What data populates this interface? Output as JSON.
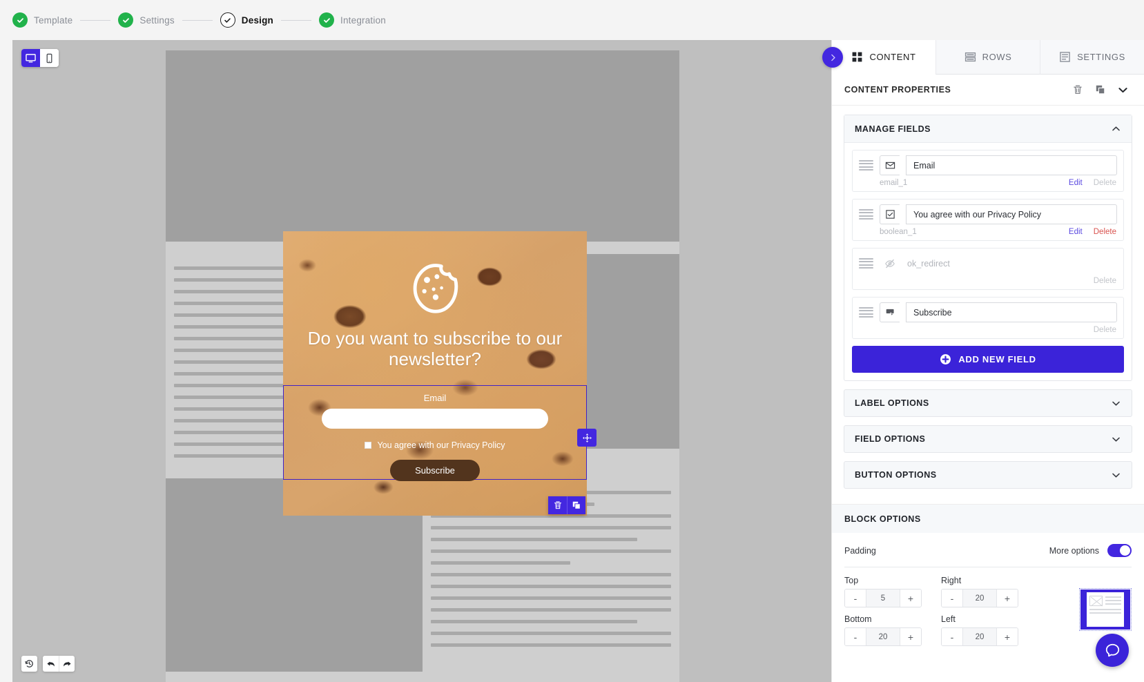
{
  "stepper": {
    "steps": [
      {
        "label": "Template",
        "state": "done"
      },
      {
        "label": "Settings",
        "state": "done"
      },
      {
        "label": "Design",
        "state": "current"
      },
      {
        "label": "Integration",
        "state": "done"
      }
    ]
  },
  "canvas": {
    "view_desktop_icon": "desktop-icon",
    "view_mobile_icon": "mobile-icon",
    "history_icon": "history-icon",
    "undo_icon": "undo-icon",
    "redo_icon": "redo-icon"
  },
  "popup": {
    "logo_icon": "cookie-icon",
    "title": "Do you want to subscribe to our newsletter?",
    "email_label": "Email",
    "email_value": "",
    "email_placeholder": "",
    "consent_label": "You agree with our Privacy Policy",
    "consent_checked": false,
    "submit_label": "Subscribe",
    "move_handle_icon": "move-icon",
    "delete_icon": "trash-icon",
    "duplicate_icon": "duplicate-icon"
  },
  "panel": {
    "collapse_icon": "chevron-right-icon",
    "tabs": [
      {
        "label": "CONTENT",
        "icon": "grid-icon",
        "active": true
      },
      {
        "label": "ROWS",
        "icon": "rows-icon",
        "active": false
      },
      {
        "label": "SETTINGS",
        "icon": "settings-list-icon",
        "active": false
      }
    ],
    "properties": {
      "title": "CONTENT PROPERTIES",
      "delete_icon": "trash-icon",
      "duplicate_icon": "duplicate-icon",
      "collapse_icon": "chevron-down-icon"
    },
    "manage_fields": {
      "title": "MANAGE FIELDS",
      "collapse_icon": "chevron-up-icon",
      "fields": [
        {
          "icon": "envelope-icon",
          "name": "Email",
          "key": "email_1",
          "edit_label": "Edit",
          "delete_label": "Delete",
          "edit_enabled": true,
          "delete_enabled": false,
          "has_name_box": true
        },
        {
          "icon": "checkbox-icon",
          "name": "You agree with our Privacy Policy",
          "key": "boolean_1",
          "edit_label": "Edit",
          "delete_label": "Delete",
          "edit_enabled": true,
          "delete_enabled": true,
          "has_name_box": true
        },
        {
          "icon": "hidden-eye-icon",
          "name": "ok_redirect",
          "key": "",
          "edit_label": "",
          "delete_label": "Delete",
          "edit_enabled": false,
          "delete_enabled": false,
          "has_name_box": false
        },
        {
          "icon": "button-click-icon",
          "name": "Subscribe",
          "key": "",
          "edit_label": "",
          "delete_label": "Delete",
          "edit_enabled": false,
          "delete_enabled": false,
          "has_name_box": true
        }
      ],
      "add_button_label": "ADD NEW FIELD",
      "add_button_icon": "plus-circle-icon"
    },
    "accordions": [
      {
        "label": "LABEL OPTIONS",
        "icon": "chevron-down-icon"
      },
      {
        "label": "FIELD OPTIONS",
        "icon": "chevron-down-icon"
      },
      {
        "label": "BUTTON OPTIONS",
        "icon": "chevron-down-icon"
      }
    ],
    "block_options": {
      "title": "BLOCK OPTIONS",
      "padding_label": "Padding",
      "more_options_label": "More options",
      "more_options_on": true,
      "paddings": [
        {
          "label": "Top",
          "value": "5",
          "minus": "-",
          "plus": "+"
        },
        {
          "label": "Right",
          "value": "20",
          "minus": "-",
          "plus": "+"
        },
        {
          "label": "Bottom",
          "value": "20",
          "minus": "-",
          "plus": "+"
        },
        {
          "label": "Left",
          "value": "20",
          "minus": "-",
          "plus": "+"
        }
      ]
    }
  },
  "help": {
    "icon": "chat-help-icon"
  },
  "colors": {
    "accent": "#4327e0",
    "accent_button": "#3b23d9",
    "success": "#21b24b",
    "danger": "#d9534f",
    "cookie_button": "#52341d"
  }
}
